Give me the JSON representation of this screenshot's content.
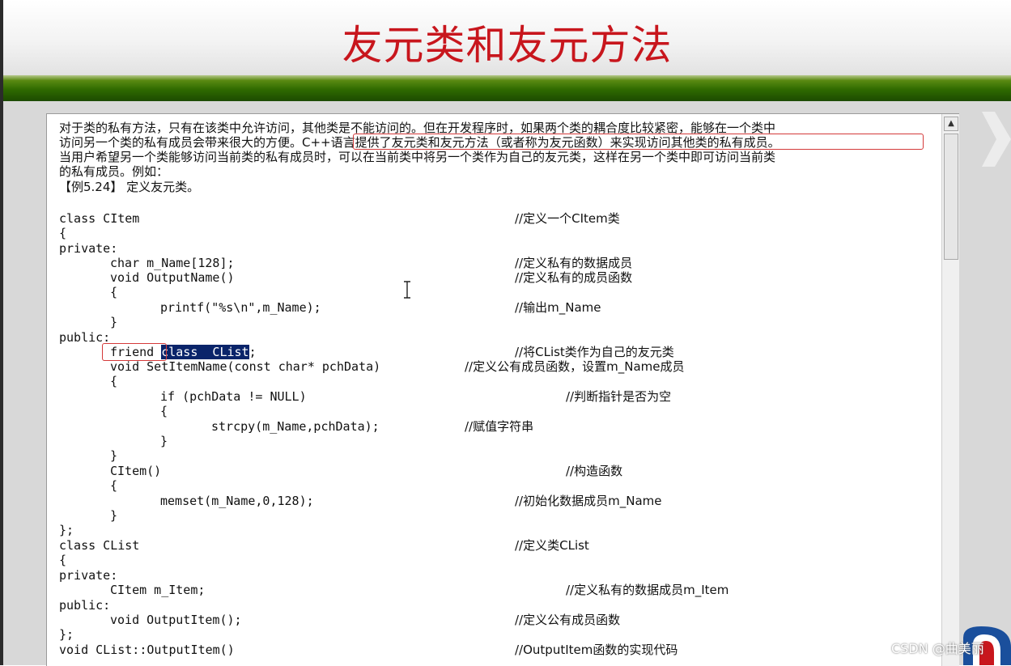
{
  "slide": {
    "title": "友元类和友元方法"
  },
  "document": {
    "intro": [
      "对于类的私有方法，只有在该类中允许访问，其他类是不能访问的。但在开发程序时，如果两个类的耦合度比较紧密，能够在一个类中",
      "访问另一个类的私有成员会带来很大的方便。C++语言提供了友元类和友元方法（或者称为友元函数）来实现访问其他类的私有成员。",
      "当用户希望另一个类能够访问当前类的私有成员时，可以在当前类中将另一个类作为自己的友元类，这样在另一个类中即可访问当前类",
      "的私有成员。例如："
    ],
    "example": "【例5.24】 定义友元类。",
    "code": {
      "l01": "class CItem",
      "c01": "//定义一个CItem类",
      "l02": "{",
      "l03": "private:",
      "l04": "char m_Name[128];",
      "c04": "//定义私有的数据成员",
      "l05": "void OutputName()",
      "c05": "//定义私有的成员函数",
      "l06": "{",
      "l07": "printf(\"%s\\n\",m_Name);",
      "c07": "//输出m_Name",
      "l08": "}",
      "l09": "public:",
      "l10a": "friend",
      "l10b": "class  CList",
      "l10c": ";",
      "c10": "//将CList类作为自己的友元类",
      "l11": "void SetItemName(const char* pchData)",
      "c11": "//定义公有成员函数，设置m_Name成员",
      "l12": "{",
      "l13": "if (pchData != NULL)",
      "c13": "//判断指针是否为空",
      "l14": "{",
      "l15": "strcpy(m_Name,pchData);",
      "c15": "//赋值字符串",
      "l16": "}",
      "l17": "}",
      "l18": "CItem()",
      "c18": "//构造函数",
      "l19": "{",
      "l20": "memset(m_Name,0,128);",
      "c20": "//初始化数据成员m_Name",
      "l21": "}",
      "l22": "};",
      "l23": "class CList",
      "c23": "//定义类CList",
      "l24": "{",
      "l25": "private:",
      "l26": "CItem m_Item;",
      "c26": "//定义私有的数据成员m_Item",
      "l27": "public:",
      "l28": "void OutputItem();",
      "c28": "//定义公有成员函数",
      "l29": "};",
      "l30": "void CList::OutputItem()",
      "c30": "//OutputItem函数的实现代码"
    }
  },
  "watermark": "CSDN @曲美丽",
  "colors": {
    "title": "#c8161d",
    "band": "#2f6a00",
    "highlight": "#0a246a",
    "annotation": "#d43a3a"
  }
}
